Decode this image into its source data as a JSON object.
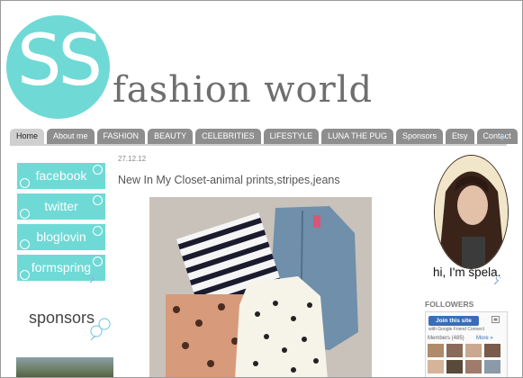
{
  "header": {
    "logo_letters": "SS",
    "site_title": "fashion world"
  },
  "nav": {
    "tabs": [
      {
        "label": "Home",
        "active": true
      },
      {
        "label": "About me"
      },
      {
        "label": "FASHION"
      },
      {
        "label": "BEAUTY"
      },
      {
        "label": "CELEBRITIES"
      },
      {
        "label": "LIFESTYLE"
      },
      {
        "label": "LUNA THE PUG"
      },
      {
        "label": "Sponsors"
      },
      {
        "label": "Etsy"
      },
      {
        "label": "Contact"
      }
    ]
  },
  "sidebar_left": {
    "social_links": [
      {
        "label": "facebook"
      },
      {
        "label": "twitter"
      },
      {
        "label": "bloglovin"
      },
      {
        "label": "formspring"
      }
    ],
    "sponsors_heading": "sponsors"
  },
  "post": {
    "date": "27.12.12",
    "title": "New In My Closet-animal prints,stripes,jeans"
  },
  "sidebar_right": {
    "profile_caption": "hi, I'm spela.",
    "followers_title": "FOLLOWERS",
    "join_button": "Join this site",
    "gfc_subtext": "with Google Friend Connect",
    "members_label": "Members (485)",
    "more_link": "More »"
  },
  "colors": {
    "accent": "#6fd9d6",
    "nav_tab": "#8e8e8e",
    "nav_tab_active": "#cfcfcf",
    "title_gray": "#6e6e6e"
  }
}
